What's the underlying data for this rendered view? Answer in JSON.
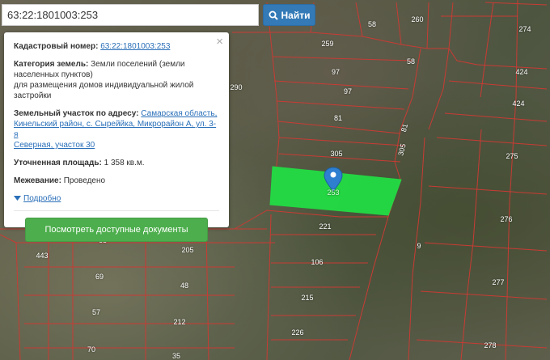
{
  "search": {
    "value": "63:22:1801003:253",
    "button_label": "Найти",
    "button_icon": "search-icon"
  },
  "popup": {
    "cadastral_label": "Кадастровый номер:",
    "cadastral_value": "63:22:1801003:253",
    "category_label": "Категория земель:",
    "category_value_line1": "Земли поселений (земли",
    "category_value_line2": "населенных пунктов)",
    "category_value_line3": "для размещения домов индивидуальной жилой",
    "category_value_line4": "застройки",
    "address_label": "Земельный участок по адресу:",
    "address_value_line1": "Самарская область,",
    "address_value_line2": "Кинельский район, с. Сыреййка, Микрорайон А, ул. 3-я",
    "address_value_line3": "Северная, участок 30",
    "area_label": "Уточненная площадь:",
    "area_value": "1 358 кв.м.",
    "survey_label": "Межевание:",
    "survey_value": "Проведено",
    "details_label": "Подробно",
    "docs_button": "Посмотреть доступные документы",
    "close_icon": "close-icon"
  },
  "map": {
    "selected_parcel_label": "253",
    "plot_numbers": [
      "58",
      "260",
      "274",
      "259",
      "424",
      "58",
      "97",
      "424",
      "97",
      "81",
      "305",
      "305",
      "81",
      "275",
      "221",
      "276",
      "68",
      "443",
      "205",
      "106",
      "9",
      "69",
      "48",
      "277",
      "215",
      "57",
      "212",
      "226",
      "70",
      "35",
      "278",
      "290"
    ]
  },
  "colors": {
    "parcel_fill": "#22dd44",
    "parcel_stroke": "#c0392b",
    "marker": "#2f7fd1",
    "button_blue": "#337ab7",
    "button_green": "#4cae4c"
  }
}
